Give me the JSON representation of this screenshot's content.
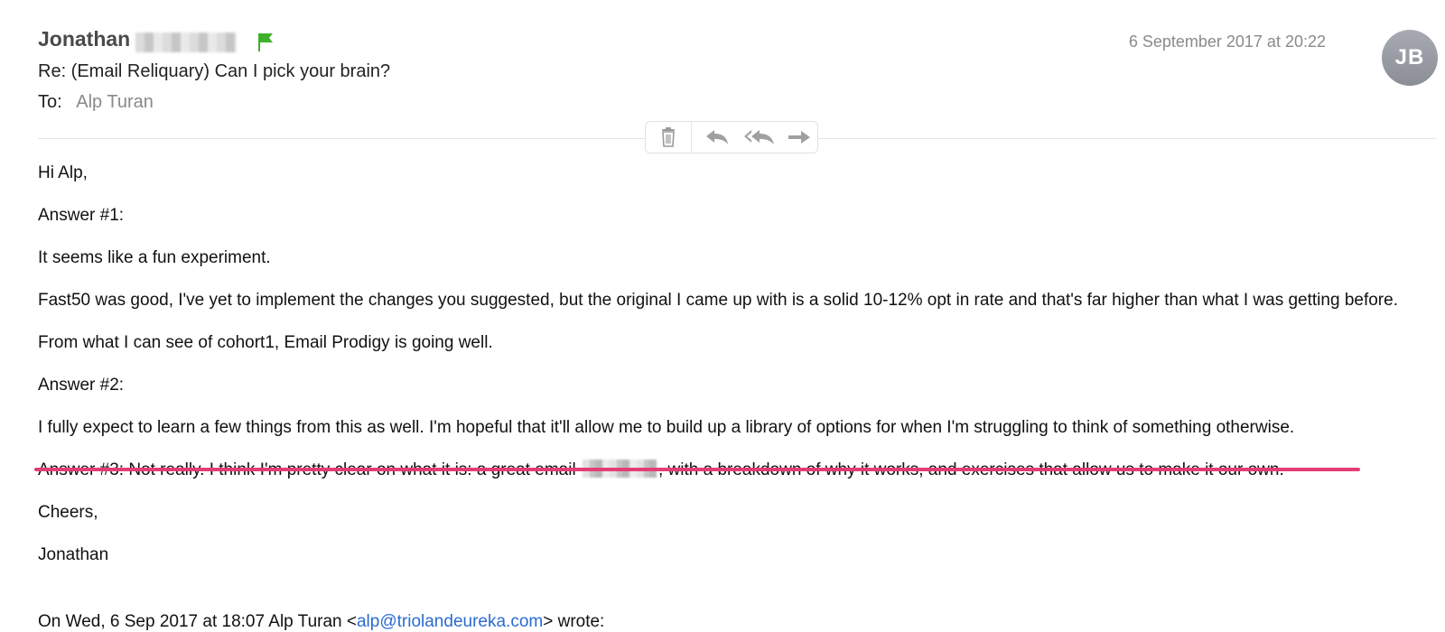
{
  "header": {
    "sender_name": "Jonathan",
    "date": "6 September 2017 at 20:22",
    "avatar_initials": "JB",
    "subject": "Re: (Email Reliquary) Can I pick your brain?",
    "to_label": "To:",
    "to_value": "Alp Turan"
  },
  "toolbar": {
    "icons": [
      "trash-icon",
      "reply-icon",
      "reply-all-icon",
      "forward-icon"
    ]
  },
  "body": {
    "greeting": "Hi Alp,",
    "answer1_label": "Answer #1:",
    "answer1_p1": "It seems like a fun experiment.",
    "answer1_p2": "Fast50 was good, I've yet to implement the changes you suggested, but the original I came up with is a solid 10-12% opt in rate and that's far higher than what I was getting before.",
    "answer1_p3": "From what I can see of cohort1, Email Prodigy is going well.",
    "answer2_label": "Answer #2:",
    "answer2_text": "I fully expect to learn a few things from this as well. I'm hopeful that it'll allow me to build up a library of options for when I'm struggling to think of something otherwise.",
    "answer3_before": "Answer #3: Not really. I think I'm pretty clear on what it is: a great email",
    "answer3_after": ", with a breakdown of why it works, and exercises that allow us to make it our own.",
    "signoff": "Cheers,",
    "signature": "Jonathan",
    "quote_prefix": "On Wed, 6 Sep 2017 at 18:07 Alp Turan <",
    "quote_email": "alp@triolandeureka.com",
    "quote_suffix": "> wrote:"
  },
  "colors": {
    "flag": "#3fb02a",
    "highlight_underline": "#e23e74",
    "link": "#2a6bd0",
    "meta_gray": "#8a8a8a"
  }
}
